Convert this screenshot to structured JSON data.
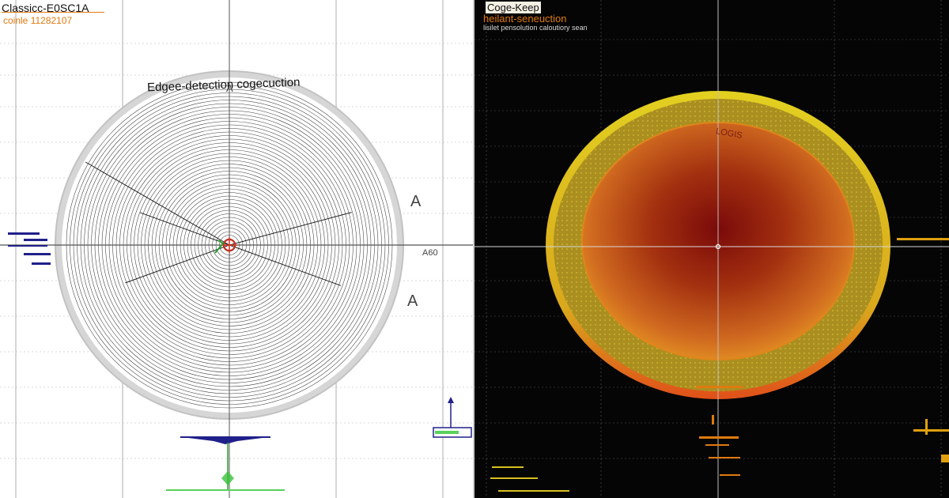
{
  "left_panel": {
    "title": "Classicc-E0SC1A",
    "subtitle": "coinle 11282107",
    "circle_label": "Edgee-detection cogecuction",
    "axis_marker_top": "A",
    "axis_marker_right_1": "A",
    "axis_marker_right_2": "A",
    "right_side_label": "A60",
    "colors": {
      "background": "#ffffff",
      "grid": "#9a9a9a",
      "ring": "#c8c8c8",
      "rings": "#3a3a3a",
      "accent": "#e07a10",
      "center_mark": "#d03020",
      "marker_green": "#2aa02a",
      "marker_blue": "#20208a"
    },
    "icons": [
      "crosshair-icon",
      "arrow-up-icon"
    ]
  },
  "right_panel": {
    "title": "Coge-Keep",
    "subtitle": "heilant-seneuction",
    "subtitle_2": "lisilet pensolution caloutiory sean",
    "inner_label": "LOGIS",
    "colors": {
      "background": "#050505",
      "grid": "#6a6a6a",
      "outer_ring": "#d9c21a",
      "band": "#a89222",
      "inner_edge": "#e0851a",
      "center": "#7a0a0a",
      "accent": "#e07a10"
    },
    "icons": [
      "crosshair-icon"
    ]
  }
}
